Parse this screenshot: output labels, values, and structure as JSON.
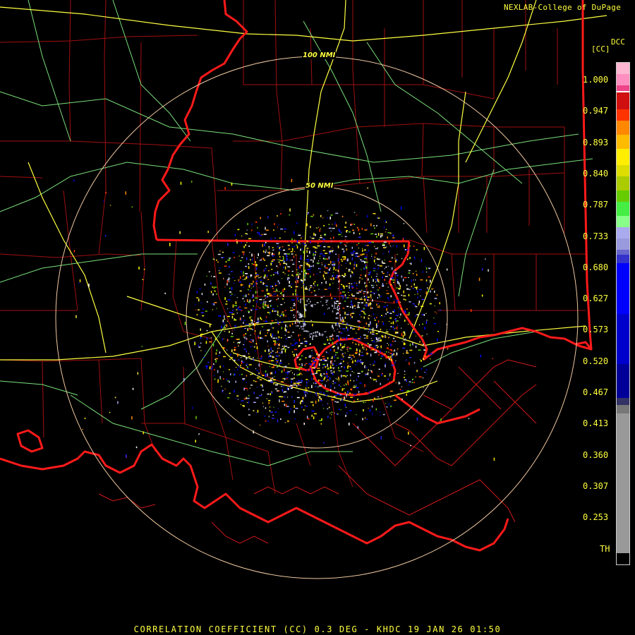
{
  "credit": "NEXLAB-College of DuPage",
  "scale": {
    "product": "DCC",
    "unit": "[CC]",
    "labels": [
      "1.000",
      "0.947",
      "0.893",
      "0.840",
      "0.787",
      "0.733",
      "0.680",
      "0.627",
      "0.573",
      "0.520",
      "0.467",
      "0.413",
      "0.360",
      "0.307",
      "0.253",
      "TH"
    ]
  },
  "range_rings": {
    "inner": "50 NMI",
    "outer": "100 NMI"
  },
  "footer": "CORRELATION COEFFICIENT (CC) 0.3 DEG - KHDC 19 JAN 26 01:50",
  "colors": {
    "state_border": "#ff2020",
    "county_border": "#b01010",
    "highway_major": "#ffff40",
    "highway_minor": "#88ee88",
    "ring": "#f0c8a0",
    "text": "#ffff40"
  }
}
